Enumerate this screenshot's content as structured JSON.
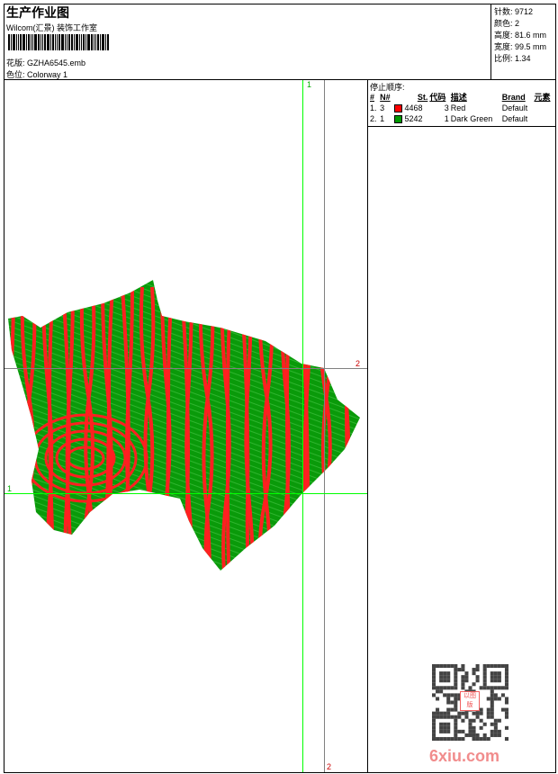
{
  "header": {
    "title": "生产作业图",
    "company": "Wilcom(汇景) 装饰工作室",
    "file_label": "花版:",
    "file_value": "GZHA6545.emb",
    "colorway_label": "色位:",
    "colorway_value": "Colorway 1"
  },
  "info": [
    {
      "label": "针数:",
      "value": "9712"
    },
    {
      "label": "颜色:",
      "value": "2"
    },
    {
      "label": "高度:",
      "value": "81.6 mm"
    },
    {
      "label": "宽度:",
      "value": "99.5 mm"
    },
    {
      "label": "比例:",
      "value": "1.34"
    }
  ],
  "stop_sequence": {
    "title": "停止顺序:",
    "columns": [
      "#",
      "N#",
      "St.",
      "代码",
      "描述",
      "Brand",
      "元素"
    ],
    "rows": [
      {
        "index": "1.",
        "n": "3",
        "color": "#ff0000",
        "stitches": "4468",
        "code": "3",
        "desc": "Red",
        "brand": "Default"
      },
      {
        "index": "2.",
        "n": "1",
        "color": "#009900",
        "stitches": "5242",
        "code": "1",
        "desc": "Dark Green",
        "brand": "Default"
      }
    ]
  },
  "guides": {
    "v1": "1",
    "v2": "2",
    "h1": "1",
    "h2": "2"
  },
  "colors": {
    "green_guide": "#00ff00",
    "gray_guide": "#808080",
    "stitch_red": "#ff2020",
    "stitch_green": "#0a9a0a"
  },
  "watermark": {
    "text": "6xiu.com",
    "stamp": "以图版"
  }
}
